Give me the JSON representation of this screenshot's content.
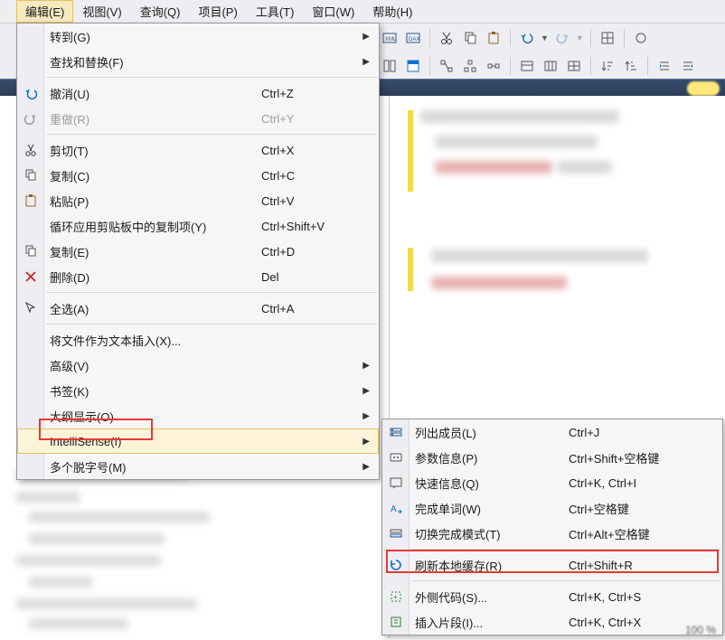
{
  "menubar": {
    "items": [
      "编辑(E)",
      "视图(V)",
      "查询(Q)",
      "项目(P)",
      "工具(T)",
      "窗口(W)",
      "帮助(H)"
    ]
  },
  "editMenu": {
    "items": [
      {
        "label": "转到(G)",
        "shortcut": "",
        "submenu": true,
        "icon": ""
      },
      {
        "label": "查找和替换(F)",
        "shortcut": "",
        "submenu": true,
        "icon": ""
      },
      {
        "sep": true
      },
      {
        "label": "撤消(U)",
        "shortcut": "Ctrl+Z",
        "icon": "undo"
      },
      {
        "label": "重做(R)",
        "shortcut": "Ctrl+Y",
        "icon": "redo",
        "disabled": true
      },
      {
        "sep": true
      },
      {
        "label": "剪切(T)",
        "shortcut": "Ctrl+X",
        "icon": "cut"
      },
      {
        "label": "复制(C)",
        "shortcut": "Ctrl+C",
        "icon": "copy"
      },
      {
        "label": "粘贴(P)",
        "shortcut": "Ctrl+V",
        "icon": "paste"
      },
      {
        "label": "循环应用剪贴板中的复制项(Y)",
        "shortcut": "Ctrl+Shift+V",
        "icon": ""
      },
      {
        "label": "复制(E)",
        "shortcut": "Ctrl+D",
        "icon": "dup"
      },
      {
        "label": "删除(D)",
        "shortcut": "Del",
        "icon": "delete"
      },
      {
        "sep": true
      },
      {
        "label": "全选(A)",
        "shortcut": "Ctrl+A",
        "icon": "select"
      },
      {
        "sep": true
      },
      {
        "label": "将文件作为文本插入(X)...",
        "shortcut": "",
        "icon": ""
      },
      {
        "label": "高级(V)",
        "shortcut": "",
        "submenu": true,
        "icon": ""
      },
      {
        "label": "书签(K)",
        "shortcut": "",
        "submenu": true,
        "icon": ""
      },
      {
        "label": "大纲显示(O)",
        "shortcut": "",
        "submenu": true,
        "icon": ""
      },
      {
        "label": "IntelliSense(I)",
        "shortcut": "",
        "submenu": true,
        "icon": "",
        "hover": true
      },
      {
        "label": "多个脱字号(M)",
        "shortcut": "",
        "submenu": true,
        "icon": ""
      }
    ]
  },
  "subMenu": {
    "items": [
      {
        "label": "列出成员(L)",
        "shortcut": "Ctrl+J",
        "icon": "members"
      },
      {
        "label": "参数信息(P)",
        "shortcut": "Ctrl+Shift+空格键",
        "icon": "params"
      },
      {
        "label": "快速信息(Q)",
        "shortcut": "Ctrl+K, Ctrl+I",
        "icon": "quick"
      },
      {
        "label": "完成单词(W)",
        "shortcut": "Ctrl+空格键",
        "icon": "word"
      },
      {
        "label": "切换完成模式(T)",
        "shortcut": "Ctrl+Alt+空格键",
        "icon": "toggle"
      },
      {
        "sep": true
      },
      {
        "label": "刷新本地缓存(R)",
        "shortcut": "Ctrl+Shift+R",
        "icon": "refresh"
      },
      {
        "sep": true
      },
      {
        "label": "外侧代码(S)...",
        "shortcut": "Ctrl+K, Ctrl+S",
        "icon": "surround"
      },
      {
        "label": "插入片段(I)...",
        "shortcut": "Ctrl+K, Ctrl+X",
        "icon": "snippet"
      }
    ]
  },
  "status": {
    "zoom": "100 %"
  }
}
